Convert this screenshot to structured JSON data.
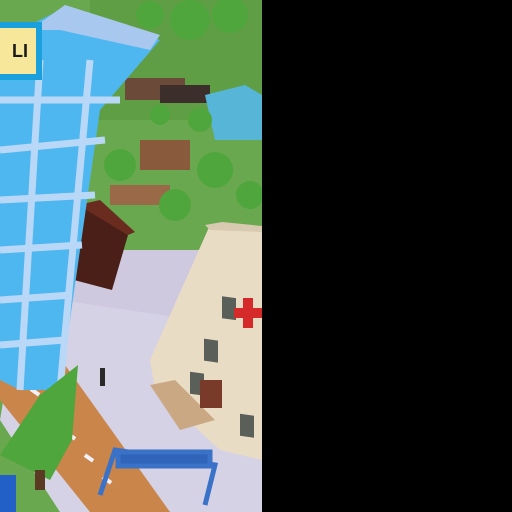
{
  "hud": {
    "badge_text": "LI"
  },
  "colors": {
    "grass": "#6aa84f",
    "road": "#c9854a",
    "tower_glass": "#4fb7f0",
    "tower_frame": "#b9d8f8",
    "hospital_wall": "#e9dcc4",
    "red_cross": "#d62a2a",
    "tree": "#4fa63c",
    "hud_border": "#1aa0dc",
    "hud_fill": "#f7e79a"
  },
  "scene": {
    "objects": [
      "skyscraper",
      "hospital",
      "trees",
      "road",
      "crosswalk",
      "sign-arch",
      "dark-house",
      "distant-buildings"
    ]
  }
}
